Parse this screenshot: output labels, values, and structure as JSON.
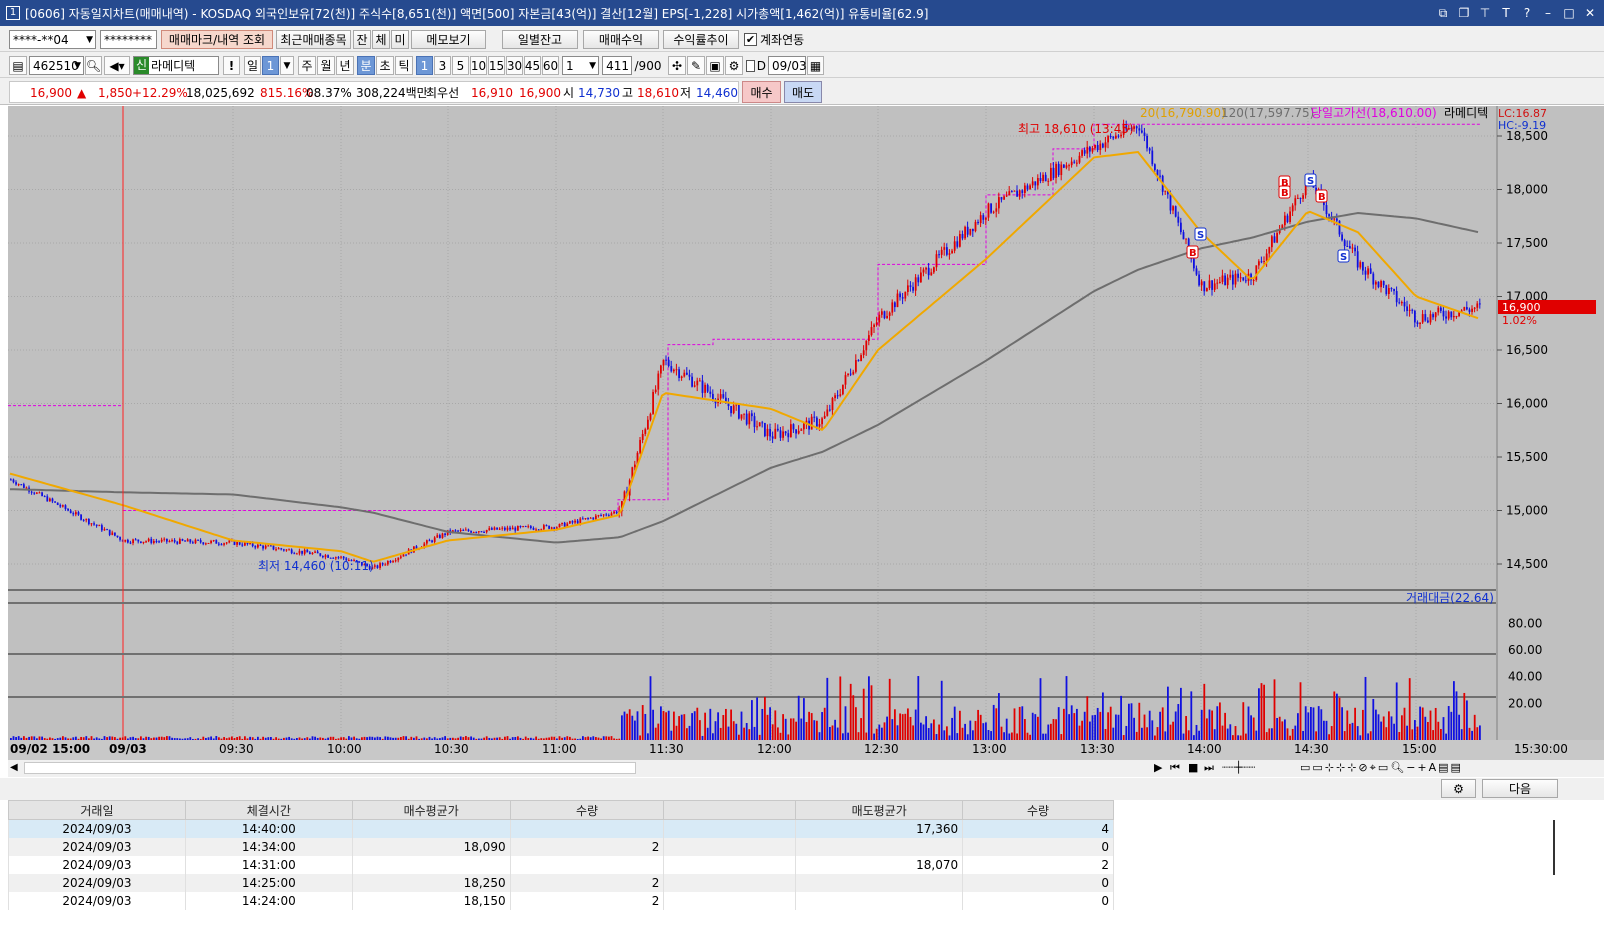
{
  "window": {
    "title": "[0606] 자동일지차트(매매내역) - KOSDAQ 외국인보유[72(천)] 주식수[8,651(천)] 액면[500] 자본금[43(억)] 결산[12월] EPS[-1,228] 시가총액[1,462(억)] 유통비율[62.9]",
    "app_icon": "1"
  },
  "toolbar1": {
    "account": "****-**04",
    "password": "********",
    "btn_trade_marks": "매매마크/내역 조회",
    "btn_recent": "최근매매종목",
    "btn_jan": "잔",
    "btn_che": "체",
    "btn_mi": "미",
    "btn_memo": "메모보기",
    "btn_daily_balance": "일별잔고",
    "btn_trade_profit": "매매수익",
    "btn_return_trend": "수익률추이",
    "link_account_label": "계좌연동",
    "link_account_checked": true
  },
  "toolbar2": {
    "stock_code": "462510",
    "stock_prefix": "신",
    "stock_name": "라메디텍",
    "period_buttons": [
      "일",
      "1",
      "주",
      "월",
      "년",
      "분",
      "초",
      "틱"
    ],
    "selected_period": "분",
    "interval_buttons": [
      "1",
      "3",
      "5",
      "10",
      "15",
      "30",
      "45",
      "60"
    ],
    "selected_interval": "1",
    "multiplier": "1",
    "count": "411",
    "count_total": "/900",
    "date_checkbox_label": "D",
    "date": "09/03"
  },
  "quote": {
    "price": "16,900",
    "direction": "▲",
    "change": "1,850",
    "change_pct": "+12.29%",
    "volume": "18,025,692",
    "volume_ratio": "815.16%",
    "turnover": "08.37%",
    "trade_value": "308,224백만",
    "best_label": "최우선",
    "ask": "16,910",
    "bid": "16,900",
    "open_label": "시",
    "open": "14,730",
    "high_label": "고",
    "high": "18,610",
    "low_label": "저",
    "low": "14,460",
    "buy_btn": "매수",
    "sell_btn": "매도"
  },
  "chart": {
    "legend_ma20": "20(16,790.90)",
    "legend_ma120": "120(17,597.75)",
    "legend_day_high": "당일고가선(18,610.00)",
    "stock_label": "라메디텍",
    "lc": "LC:16.87",
    "hc": "HC:-9.19",
    "high_mark": "최고 18,610 (13:45)",
    "low_mark": "최저 14,460 (10:11)",
    "current_price_tag": "16,900",
    "current_pct_tag": "1.02%",
    "volume_legend": "거래대금(22.64)",
    "price_ticks": [
      "18,500",
      "18,000",
      "17,500",
      "17,000",
      "16,500",
      "16,000",
      "15,500",
      "15,000",
      "14,500"
    ],
    "volume_ticks": [
      "80.00",
      "60.00",
      "40.00",
      "20.00"
    ],
    "time_ticks": [
      "09/02 15:00",
      "09/03",
      "09:30",
      "10:00",
      "10:30",
      "11:00",
      "11:30",
      "12:00",
      "12:30",
      "13:00",
      "13:30",
      "14:00",
      "14:30",
      "15:00",
      "15:30:00"
    ],
    "trade_marks": [
      "B",
      "S",
      "B",
      "B",
      "S",
      "B",
      "S"
    ],
    "colors": {
      "up": "#e00000",
      "down": "#1010e0",
      "ma20": "#f0a800",
      "ma120": "#6e6e6e",
      "day_high_line": "#e000e0",
      "background": "#c0c0c0"
    }
  },
  "chart_data": {
    "type": "candlestick",
    "title": "",
    "x_unit": "time",
    "anchors_time": [
      "09/02 15:00",
      "09/03 09:00",
      "09:30",
      "10:00",
      "10:11",
      "10:30",
      "11:00",
      "11:15",
      "11:30",
      "12:00",
      "12:15",
      "12:30",
      "13:00",
      "13:30",
      "13:45",
      "14:00",
      "14:15",
      "14:30",
      "14:45",
      "15:00",
      "15:20"
    ],
    "close_price": [
      15300,
      14720,
      14700,
      14560,
      14460,
      14800,
      14850,
      15000,
      16400,
      15700,
      15850,
      16800,
      17800,
      18400,
      18610,
      17100,
      17200,
      18100,
      17300,
      16800,
      16900
    ],
    "ma20": [
      15350,
      15050,
      14720,
      14620,
      14520,
      14720,
      14820,
      14960,
      16100,
      15950,
      15750,
      16500,
      17350,
      18300,
      18350,
      17600,
      17150,
      17800,
      17600,
      17000,
      16790.9
    ],
    "ma120": [
      15200,
      15170,
      15150,
      15030,
      14980,
      14800,
      14700,
      14750,
      14900,
      15400,
      15550,
      15800,
      16400,
      17050,
      17250,
      17450,
      17550,
      17700,
      17780,
      17730,
      17597.75
    ],
    "day_high": 18610,
    "day_low": 14460,
    "ylim": [
      14300,
      18700
    ],
    "volume_ylim": [
      0,
      90
    ]
  },
  "bottom": {
    "next_btn": "다음",
    "table_headers": [
      "거래일",
      "체결시간",
      "매수평균가",
      "수량",
      "",
      "매도평균가",
      "수량"
    ],
    "rows": [
      [
        "2024/09/03",
        "14:40:00",
        "",
        "",
        "",
        "17,360",
        "4"
      ],
      [
        "2024/09/03",
        "14:34:00",
        "18,090",
        "2",
        "",
        "",
        "0"
      ],
      [
        "2024/09/03",
        "14:31:00",
        "",
        "",
        "",
        "18,070",
        "2"
      ],
      [
        "2024/09/03",
        "14:25:00",
        "18,250",
        "2",
        "",
        "",
        "0"
      ],
      [
        "2024/09/03",
        "14:24:00",
        "18,150",
        "2",
        "",
        "",
        "0"
      ]
    ]
  }
}
